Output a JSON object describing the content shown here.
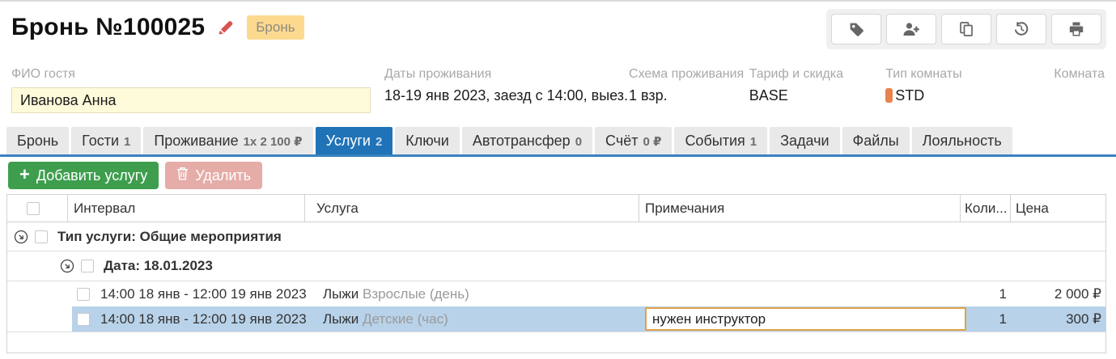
{
  "header": {
    "title": "Бронь №100025",
    "status_badge": "Бронь"
  },
  "fields": {
    "guest": {
      "label": "ФИО гостя",
      "value": "Иванова Анна"
    },
    "dates": {
      "label": "Даты проживания",
      "value": "18-19 янв 2023, заезд с 14:00, выез..."
    },
    "scheme": {
      "label": "Схема проживания",
      "value": "1 взр."
    },
    "tariff": {
      "label": "Тариф и скидка",
      "value": "BASE"
    },
    "room_type": {
      "label": "Тип комнаты",
      "value": "STD"
    },
    "room": {
      "label": "Комната",
      "value": ""
    }
  },
  "tabs": [
    {
      "label": "Бронь",
      "badge": ""
    },
    {
      "label": "Гости",
      "badge": "1"
    },
    {
      "label": "Проживание",
      "badge": "1x 2 100 ₽"
    },
    {
      "label": "Услуги",
      "badge": "2"
    },
    {
      "label": "Ключи",
      "badge": ""
    },
    {
      "label": "Автотрансфер",
      "badge": "0"
    },
    {
      "label": "Счёт",
      "badge": "0 ₽"
    },
    {
      "label": "События",
      "badge": "1"
    },
    {
      "label": "Задачи",
      "badge": ""
    },
    {
      "label": "Файлы",
      "badge": ""
    },
    {
      "label": "Лояльность",
      "badge": ""
    }
  ],
  "actions": {
    "add_service": "Добавить услугу",
    "delete": "Удалить"
  },
  "grid": {
    "columns": {
      "interval": "Интервал",
      "service": "Услуга",
      "notes": "Примечания",
      "qty": "Коли...",
      "price": "Цена"
    },
    "group1": "Тип услуги: Общие мероприятия",
    "group2": "Дата: 18.01.2023",
    "rows": [
      {
        "interval": "14:00 18 янв - 12:00 19 янв 2023",
        "service": "Лыжи",
        "service_detail": "Взрослые (день)",
        "notes": "",
        "qty": "1",
        "price": "2 000 ₽"
      },
      {
        "interval": "14:00 18 янв - 12:00 19 янв 2023",
        "service": "Лыжи",
        "service_detail": "Детские (час)",
        "notes": "нужен инструктор",
        "qty": "1",
        "price": "300 ₽"
      }
    ]
  },
  "colors": {
    "accent_blue": "#2173b7",
    "selected_row": "#b8d2e9",
    "edit_cell_border": "#e2a14a",
    "add_button": "#3e9e4e",
    "delete_button": "#e5aca8",
    "status_badge_bg": "#fbda90",
    "guest_field_bg": "#fdfbda",
    "room_marker": "#e8834e"
  }
}
